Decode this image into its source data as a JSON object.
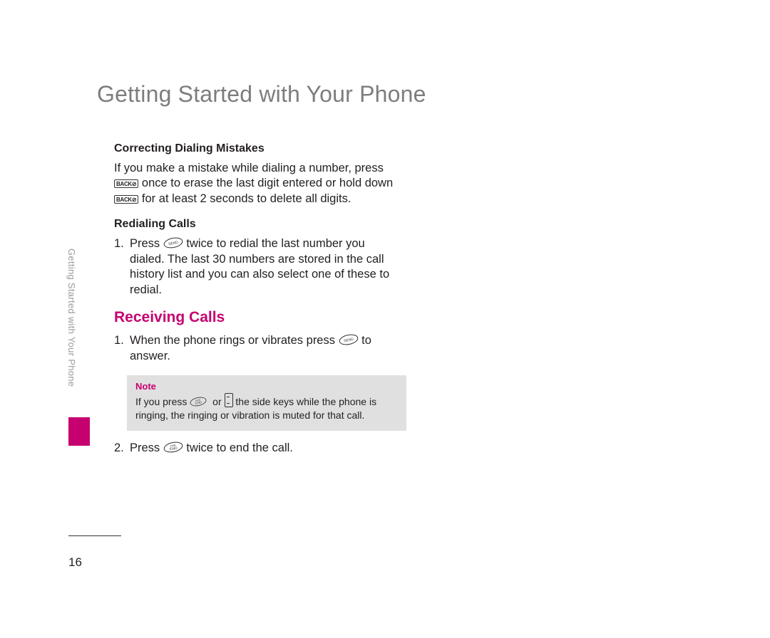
{
  "chapter_title": "Getting Started with Your Phone",
  "side_tab": "Getting Started with Your Phone",
  "page_number": "16",
  "keys": {
    "back": "BACK⊘",
    "send": "SEND",
    "end": "END",
    "end_top": "PWR"
  },
  "correcting": {
    "heading": "Correcting Dialing Mistakes",
    "p1_a": "If you make a mistake while dialing a number, press ",
    "p1_b": " once to erase the last digit entered or hold down ",
    "p1_c": " for at least 2 seconds to delete all digits."
  },
  "redialing": {
    "heading": "Redialing Calls",
    "item1_a": "Press ",
    "item1_b": " twice to redial the last number you dialed. The last 30 numbers are stored in the call history list and you can also select one of these to redial."
  },
  "receiving": {
    "heading": "Receiving Calls",
    "item1_a": "When the phone rings or vibrates press ",
    "item1_b": " to answer.",
    "item2_a": "Press ",
    "item2_b": " twice to end the call."
  },
  "note": {
    "title": "Note",
    "a": "If you press ",
    "b": " or ",
    "c": " the side keys while the phone is ringing, the ringing or vibration is muted for that call."
  }
}
